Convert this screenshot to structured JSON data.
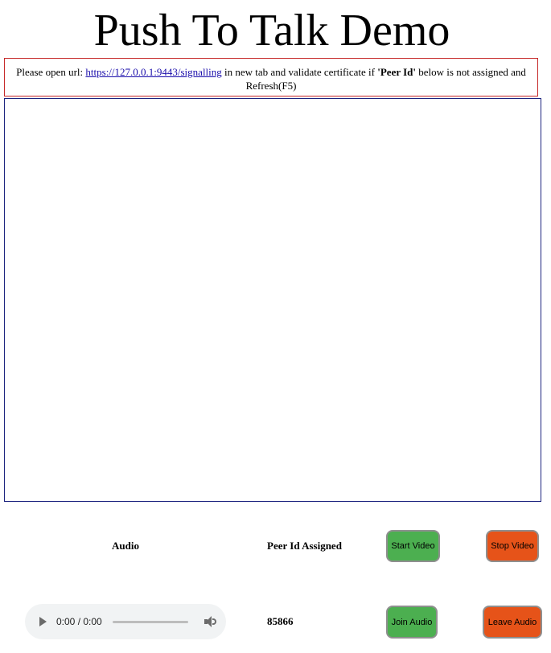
{
  "header": {
    "title": "Push To Talk Demo"
  },
  "notice": {
    "prefix": "Please open url: ",
    "url": "https://127.0.0.1:9443/signalling",
    "middle": " in new tab and validate certificate if ",
    "emphasis": "'Peer Id'",
    "suffix": " below is not assigned and Refresh(F5)"
  },
  "controls": {
    "audio_label": "Audio",
    "peer_id_label": "Peer Id Assigned",
    "start_video": "Start Video",
    "stop_video": "Stop Video",
    "join_audio": "Join Audio",
    "leave_audio": "Leave Audio",
    "peer_id_value": "85866"
  },
  "audio_player": {
    "time": "0:00 / 0:00",
    "progress": 0
  },
  "colors": {
    "notice_border": "#c62828",
    "video_border": "#1b237e",
    "start_button": "#4caf50",
    "stop_button": "#e65319"
  },
  "icons": {
    "play": "play-icon",
    "volume": "volume-icon"
  }
}
